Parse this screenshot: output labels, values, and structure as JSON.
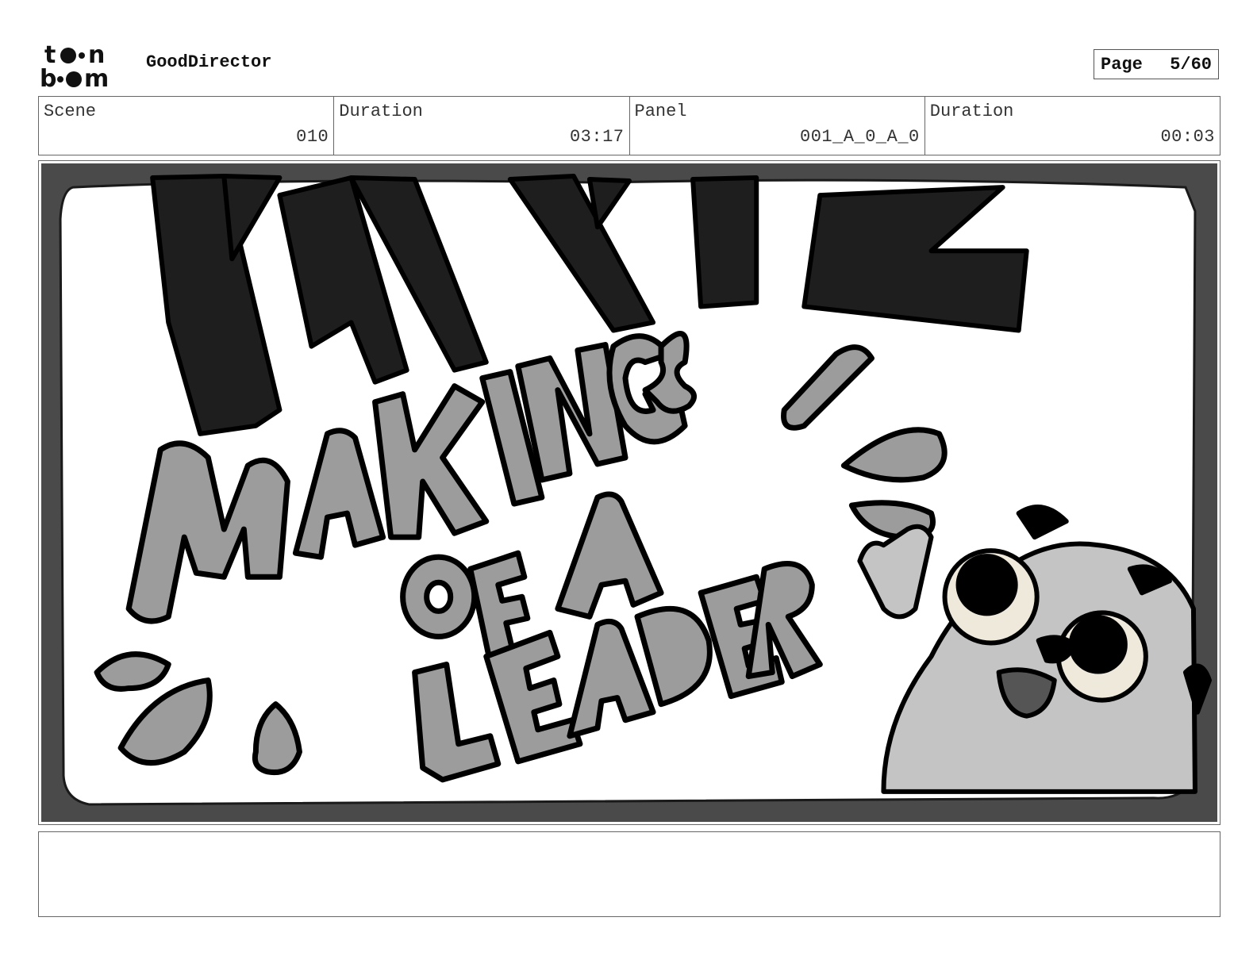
{
  "header": {
    "logo_text": "toonboom",
    "app_name": "GoodDirector",
    "page_label": "Page",
    "page_value": "5/60"
  },
  "info": {
    "scene_label": "Scene",
    "scene_value": "010",
    "scene_duration_label": "Duration",
    "scene_duration_value": "03:17",
    "panel_label": "Panel",
    "panel_value": "001_A_0_A_0",
    "panel_duration_label": "Duration",
    "panel_duration_value": "00:03"
  },
  "panel_art": {
    "lettering_top": "PART 2",
    "lettering_main": "MAKINGS OF A LEADER",
    "character": "grey-dog-character",
    "colors": {
      "frame": "#4a4a4a",
      "black_letters": "#1e1e1e",
      "grey_letters": "#9c9c9c",
      "dog": "#c4c4c4"
    }
  },
  "notes": {
    "text": ""
  }
}
